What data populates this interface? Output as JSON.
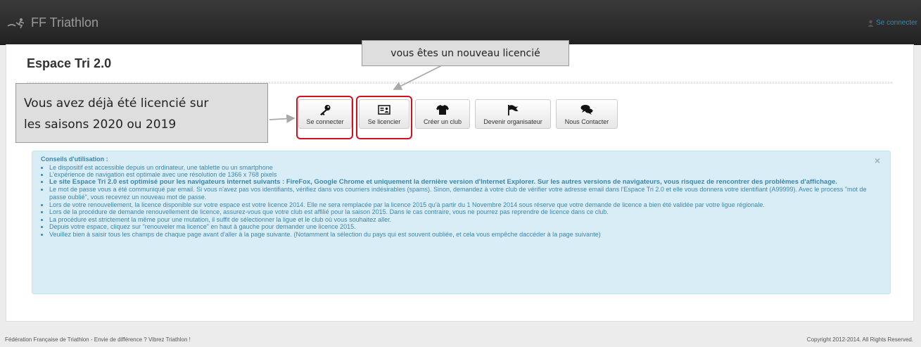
{
  "nav": {
    "brand": "FF Triathlon",
    "login_label": "Se connecter"
  },
  "page": {
    "title": "Espace Tri 2.0"
  },
  "annotations": {
    "new_member": "vous êtes un nouveau licencié",
    "returning_line1": "Vous avez déjà été licencié sur",
    "returning_line2": "les saisons 2020 ou 2019"
  },
  "buttons": {
    "login": "Se connecter",
    "register": "Se licencier",
    "create_club": "Créer un club",
    "organizer": "Devenir organisateur",
    "contact": "Nous Contacter"
  },
  "tips": {
    "title": "Conseils d'utilisation :",
    "close": "×",
    "items": [
      "Le dispositif est accessible depuis un ordinateur, une tablette ou un smartphone",
      "L'expérience de navigation est optimale avec une résolution de 1366 x 768 pixels",
      "Le site Espace Tri 2.0 est optimisé pour les navigateurs internet suivants : FireFox, Google Chrome et uniquement la dernière version d'Internet Explorer. Sur les autres versions de navigateurs, vous risquez de rencontrer des problèmes d'affichage.",
      "Le mot de passe vous a été communiqué par email. Si vous n'avez pas vos identifiants, vérifiez dans vos courriers indésirables (spams). Sinon, demandez à votre club de vérifier votre adresse email dans l'Espace Tri 2.0 et elle vous donnera votre identifiant (A99999). Avec le process \"mot de passe oublié\", vous recevrez un nouveau mot de passe.",
      "Lors de votre renouvellement, la licence disponible sur votre espace est votre licence 2014. Elle ne sera remplacée par la licence 2015 qu'à partir du 1 Novembre 2014 sous réserve que votre demande de licence a bien été validée par votre ligue régionale.",
      "Lors de la procédure de demande renouvellement de licence, assurez-vous que votre club est affilié pour la saison 2015. Dans le cas contraire, vous ne pourrez pas reprendre de licence dans ce club.",
      "La procédure est strictement la même pour une mutation, il suffit de sélectionner la ligue et le club où vous souhaitez aller.",
      "Depuis votre espace, cliquez sur \"renouveler ma licence\" en haut à gauche pour demander une licence 2015.",
      "Veuillez bien à saisir tous les champs de chaque page avant d'aller à la page suivante. (Notamment la sélection du pays qui est souvent oubliée, et cela vous empêche daccéder à la page suivante)"
    ]
  },
  "footer": {
    "left": "Fédération Française de Triathlon - Envie de différence ? Vibrez Triathlon !",
    "right": "Copyright 2012-2014. All Rights Reserved."
  },
  "colors": {
    "navbar": "#222222",
    "link": "#3a87ad",
    "alert_bg": "#d9edf7",
    "highlight": "#d0121e"
  },
  "icons": [
    "triathlon-logo-icon",
    "user-icon",
    "key-icon",
    "id-card-icon",
    "tshirt-icon",
    "flag-icon",
    "chat-icon",
    "close-icon"
  ]
}
